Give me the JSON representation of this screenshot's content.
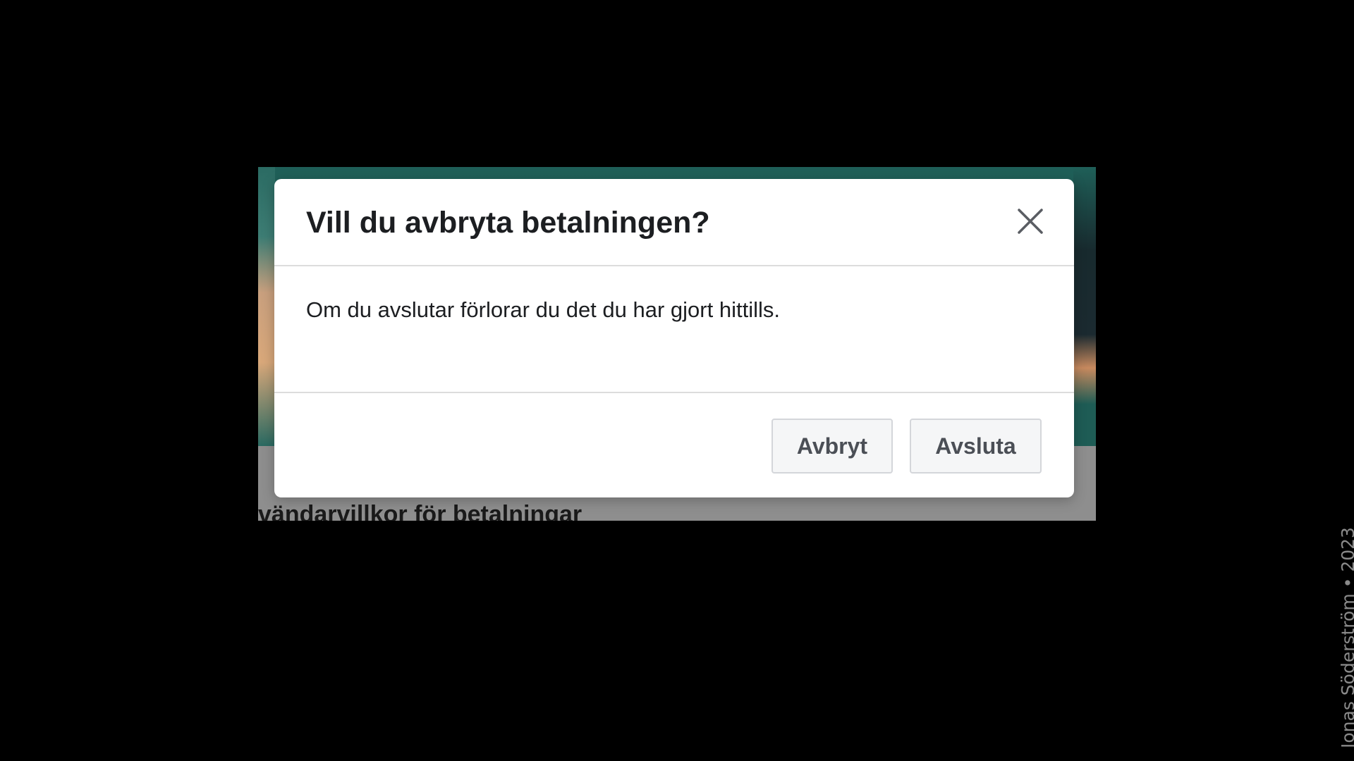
{
  "background_page": {
    "heading_fragment": "vändarvillkor för betalningar"
  },
  "dialog": {
    "title": "Vill du avbryta betalningen?",
    "close_icon": "close-icon",
    "message": "Om du avslutar förlorar du det du har gjort hittills.",
    "buttons": {
      "cancel_label": "Avbryt",
      "exit_label": "Avsluta"
    }
  },
  "credit": {
    "text": "Jonas Söderström • 2023"
  },
  "colors": {
    "page_background": "#000000",
    "dialog_background": "#ffffff",
    "title_text": "#1c1e21",
    "button_background": "#f5f6f7",
    "button_border": "#d4d6da",
    "button_text": "#4b4f56",
    "backdrop_teal": "#1f5f58",
    "overlay_gray": "#8e8e8e"
  }
}
